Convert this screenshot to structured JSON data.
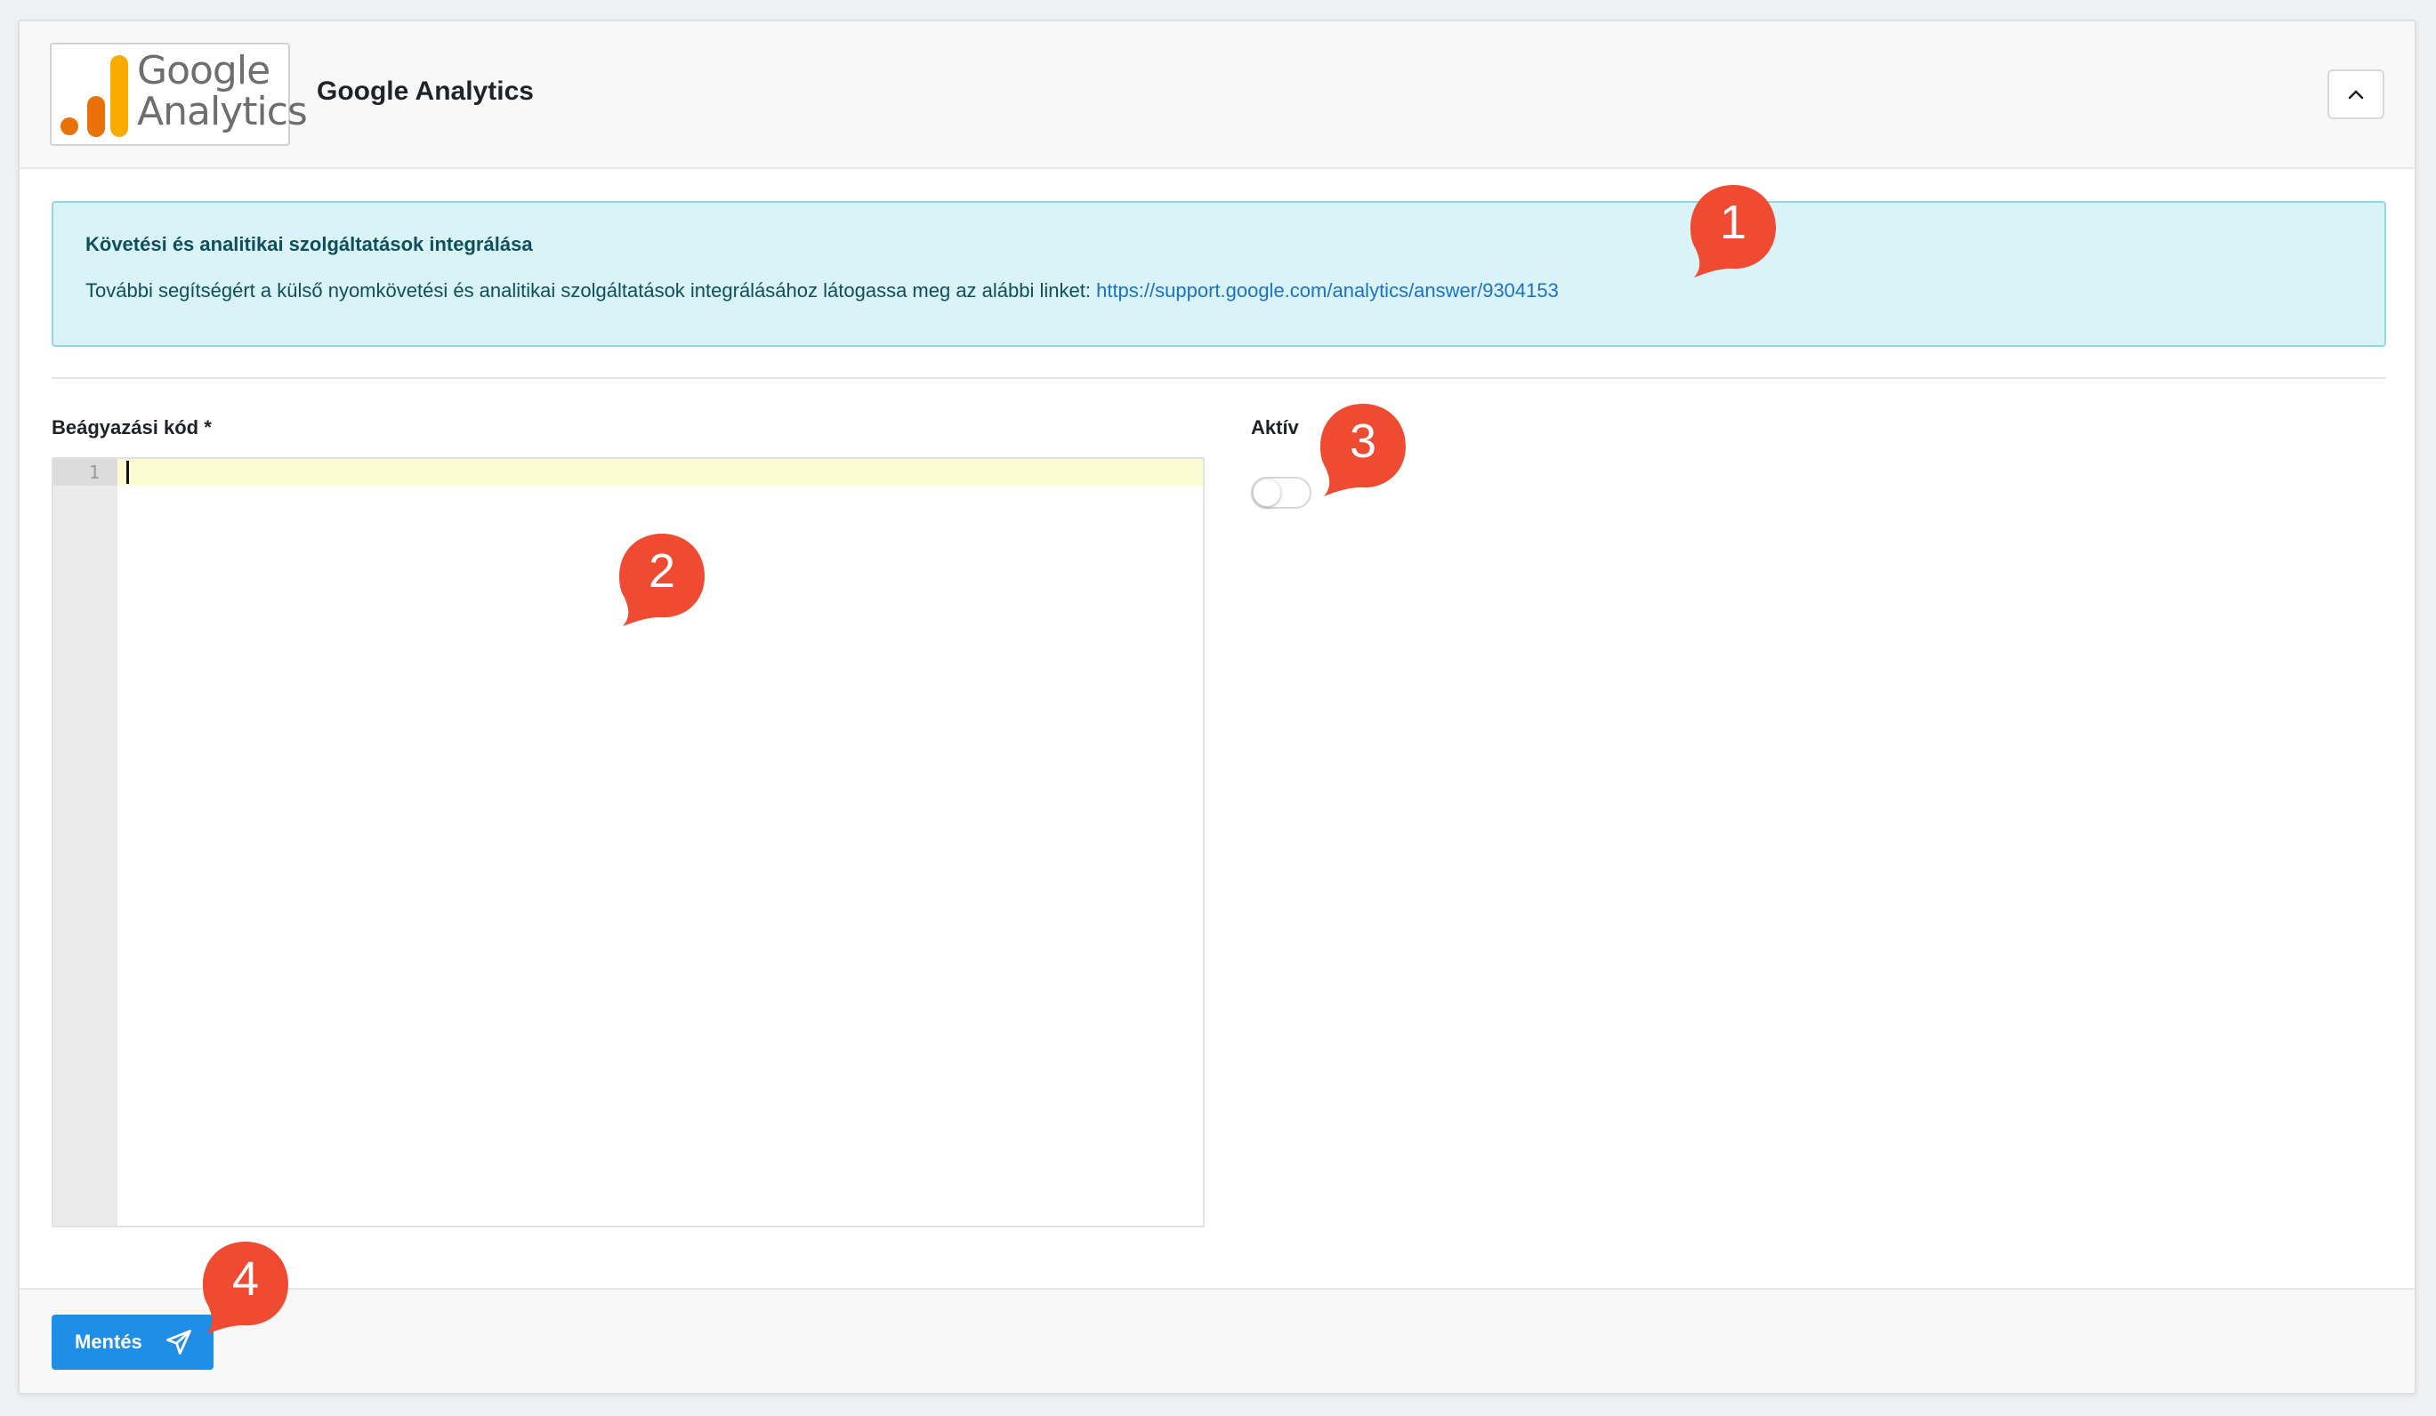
{
  "header": {
    "logo_line1": "Google",
    "logo_line2": "Analytics",
    "title": "Google Analytics",
    "collapse_icon": "chevron-up-icon"
  },
  "alert": {
    "title": "Követési és analitikai szolgáltatások integrálása",
    "text": "További segítségért a külső nyomkövetési és analitikai szolgáltatások integrálásához látogassa meg az alábbi linket: ",
    "link": "https://support.google.com/analytics/answer/9304153"
  },
  "form": {
    "embed_label": "Beágyazási kód *",
    "embed_value": "",
    "line_number": "1",
    "active_label": "Aktív",
    "active_on": false
  },
  "footer": {
    "save_label": "Mentés",
    "save_icon": "send-icon"
  },
  "markers": [
    "1",
    "2",
    "3",
    "4"
  ],
  "colors": {
    "primary": "#1e8ee6",
    "marker": "#ef4a32",
    "alert_bg": "#d9f3f7",
    "logo_orange": "#f4a012",
    "logo_dark_orange": "#e8710a"
  }
}
